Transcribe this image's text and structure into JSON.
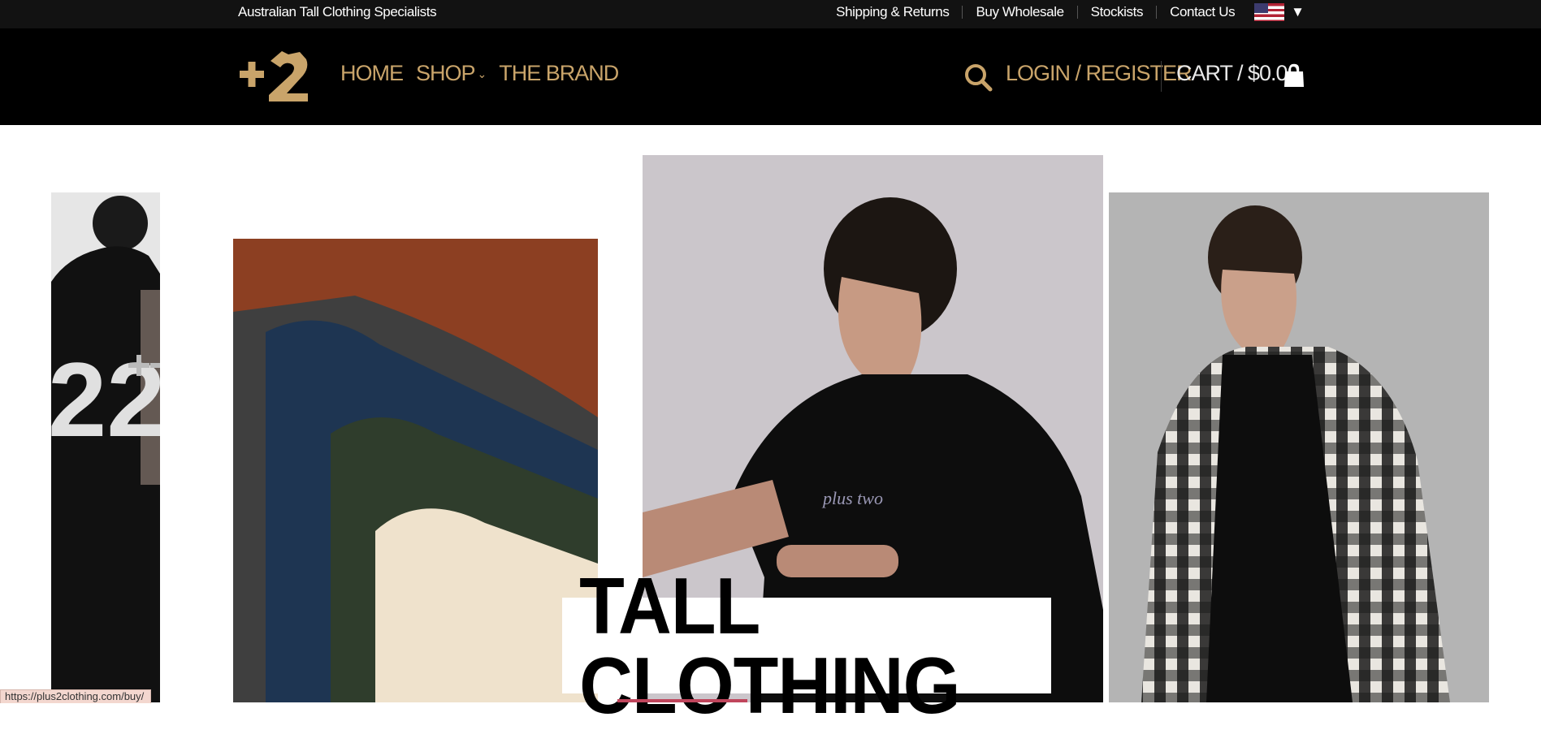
{
  "topbar": {
    "tagline": "Australian Tall Clothing Specialists",
    "links": [
      "Shipping & Returns",
      "Buy Wholesale",
      "Stockists",
      "Contact Us"
    ],
    "flag_icon": "us-flag-icon",
    "flag_caret": "▼"
  },
  "header": {
    "nav": {
      "home": "HOME",
      "shop": "SHOP",
      "shop_caret": "⌄",
      "brand": "THE BRAND"
    },
    "login": "LOGIN / REGISTER",
    "cart": "CART / $0.00",
    "colors": {
      "accent": "#c9a46a",
      "header_bg": "#000000",
      "topbar_bg": "#121212"
    }
  },
  "hero": {
    "banner_text": "TALL CLOTHING",
    "print_22": "22",
    "shirt_print": "plus two"
  },
  "status_bar": {
    "url": "https://plus2clothing.com/buy/"
  }
}
